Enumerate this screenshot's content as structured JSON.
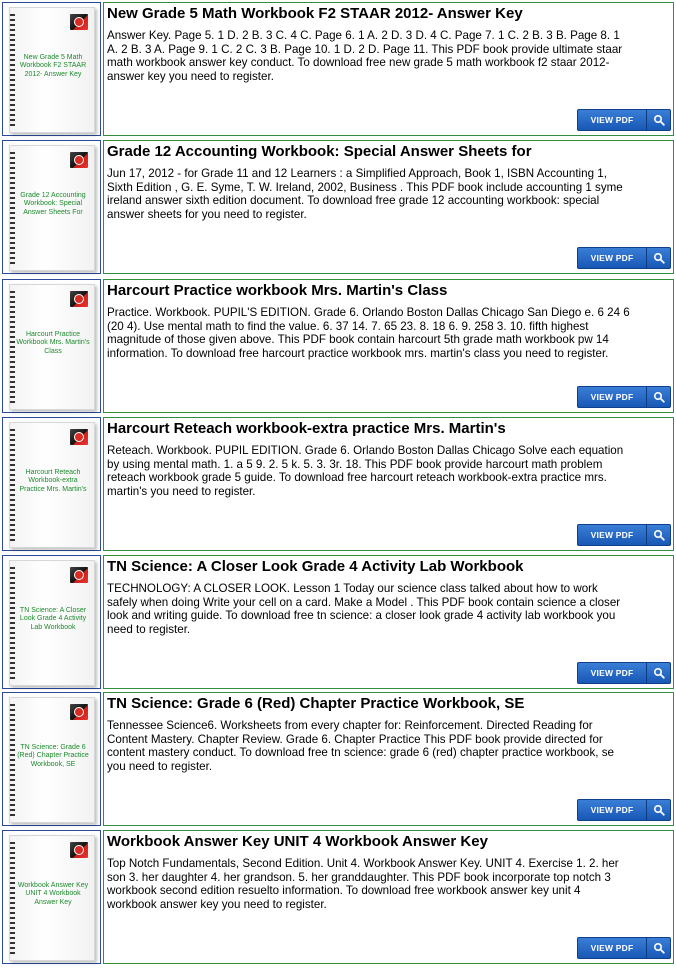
{
  "items": [
    {
      "thumb": "New Grade 5 Math Workbook F2 STAAR 2012- Answer Key",
      "title": "New Grade 5 Math Workbook F2 STAAR 2012- Answer Key",
      "lines": [
        "Answer Key. Page 5. 1 D. 2 B. 3 C. 4 C. Page 6. 1 A. 2 D. 3 D. 4 C. Page 7. 1 C. 2 B. 3 B. Page 8. 1",
        "A. 2 B. 3 A. Page 9. 1 C. 2 C. 3 B. Page 10. 1 D. 2 D. Page 11. This PDF book provide ultimate staar",
        "math workbook answer key conduct. To download free new grade 5 math workbook f2 staar 2012-",
        "answer key you need to register."
      ],
      "button": "VIEW PDF"
    },
    {
      "thumb": "Grade 12 Accounting Workbook: Special Answer Sheets For",
      "title": "Grade 12 Accounting Workbook: Special Answer Sheets for",
      "lines": [
        "Jun 17, 2012 - for Grade 11 and 12 Learners : a Simplified Approach, Book 1, ISBN Accounting 1,",
        "Sixth Edition , G. E. Syme, T. W. Ireland, 2002, Business . This PDF book include accounting 1 syme",
        "ireland answer sixth edition document. To download free grade 12 accounting workbook: special",
        "answer sheets for you need to register."
      ],
      "button": "VIEW PDF"
    },
    {
      "thumb": "Harcourt Practice Workbook Mrs. Martin's Class",
      "title": "Harcourt Practice workbook Mrs. Martin's Class",
      "lines": [
        "Practice. Workbook. PUPIL'S EDITION. Grade 6. Orlando Boston Dallas Chicago San Diego e. 6 24 6",
        "(20 4). Use mental math to find the value. 6. 37 14. 7. 65 23. 8. 18 6. 9. 258 3. 10. fifth highest",
        "magnitude of those given above. This PDF book contain harcourt 5th grade math workbook pw 14",
        "information. To download free harcourt practice workbook mrs. martin's class you need to register."
      ],
      "button": "VIEW PDF"
    },
    {
      "thumb": "Harcourt Reteach Workbook-extra Practice Mrs. Martin's",
      "title": "Harcourt Reteach workbook-extra practice Mrs. Martin's",
      "lines": [
        "Reteach. Workbook. PUPIL EDITION. Grade 6. Orlando Boston Dallas Chicago Solve each equation",
        "by using mental math. 1. a 5 9. 2. 5 k. 5. 3. 3r. 18. This PDF book provide harcourt math problem",
        "reteach workbook grade 5 guide. To download free harcourt reteach workbook-extra practice mrs.",
        "martin's you need to register."
      ],
      "button": "VIEW PDF"
    },
    {
      "thumb": "TN Science: A Closer Look Grade 4 Activity Lab Workbook",
      "title": "TN Science: A Closer Look Grade 4 Activity Lab Workbook",
      "lines": [
        "TECHNOLOGY: A CLOSER LOOK. Lesson 1 Today our science class talked about how to work",
        "safely when doing Write your cell on a card. Make a Model . This PDF book contain science a closer",
        "look and writing guide. To download free tn science: a closer look grade 4 activity lab workbook you",
        "need to register."
      ],
      "button": "VIEW PDF"
    },
    {
      "thumb": "TN Science: Grade 6 (Red) Chapter Practice Workbook, SE",
      "title": "TN Science: Grade 6 (Red) Chapter Practice Workbook, SE",
      "lines": [
        "Tennessee Science6. Worksheets from every chapter for: Reinforcement. Directed Reading for",
        "Content Mastery. Chapter Review. Grade 6. Chapter Practice  This PDF book provide directed for",
        "content mastery conduct. To download free tn science: grade 6 (red) chapter practice workbook, se",
        "you need to register."
      ],
      "button": "VIEW PDF"
    },
    {
      "thumb": "Workbook Answer Key UNIT 4 Workbook Answer Key",
      "title": "Workbook Answer Key UNIT 4 Workbook Answer Key",
      "lines": [
        "Top Notch Fundamentals, Second Edition. Unit 4. Workbook Answer Key. UNIT 4. Exercise 1. 2. her",
        "son 3. her daughter 4. her grandson. 5. her granddaughter. This PDF book incorporate top notch 3",
        "workbook second edition resuelto information. To download free workbook answer key unit 4",
        "workbook answer key you need to register."
      ],
      "button": "VIEW PDF"
    }
  ]
}
